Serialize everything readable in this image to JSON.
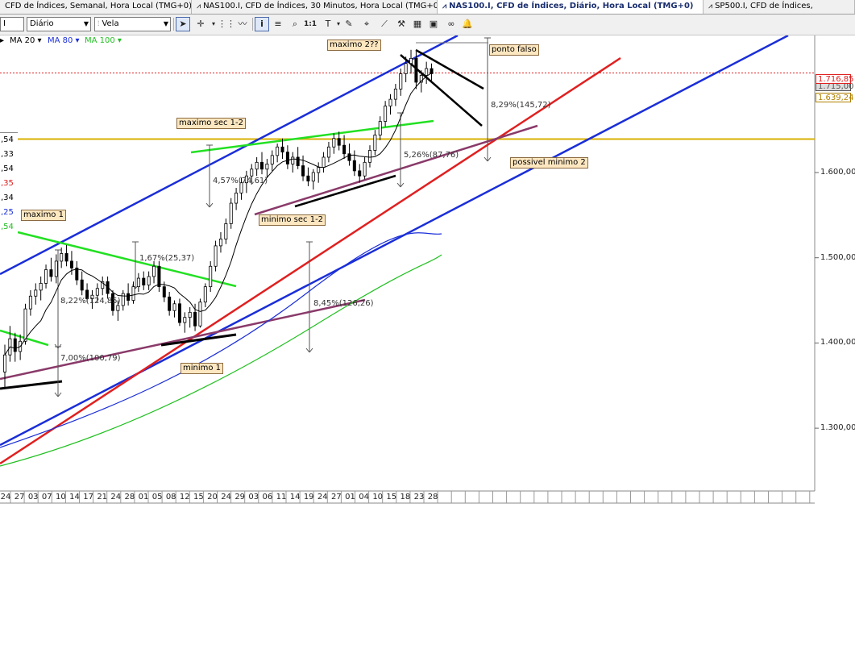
{
  "tabs": [
    {
      "label": "CFD de Índices, Semanal, Hora Local (TMG+0)",
      "active": false
    },
    {
      "label": "NAS100.I, CFD de Índices, 30 Minutos, Hora Local (TMG+0)",
      "active": false
    },
    {
      "label": "NAS100.I, CFD de Índices, Diário, Hora Local (TMG+0)",
      "active": true
    },
    {
      "label": "SP500.I, CFD de Índices,",
      "active": false
    }
  ],
  "toolbar": {
    "symbol_value": "I",
    "period_value": "Diário",
    "chart_type_value": "Vela",
    "buttons": [
      "cursor-icon",
      "crosshair-icon",
      "line-tool-icon",
      "grid-icon",
      "info-icon",
      "zoom-icon",
      "zoom-reset-label",
      "text-tool-icon",
      "draw-icon",
      "measure-icon",
      "indicator-icon",
      "table-icon",
      "compare-icon",
      "link-icon",
      "alert-icon"
    ],
    "zoom_reset_label": "1:1"
  },
  "ma_legend": {
    "ma20": {
      "label": "MA 20",
      "color": "#000000"
    },
    "ma80": {
      "label": "MA 80",
      "color": "#1a2ed8"
    },
    "ma100": {
      "label": "MA 100",
      "color": "#22c022"
    }
  },
  "left_table": [
    {
      "text": ",54",
      "color": "#000000"
    },
    {
      "text": ",33",
      "color": "#000000"
    },
    {
      "text": ",54",
      "color": "#000000"
    },
    {
      "text": ",35",
      "color": "#e02020"
    },
    {
      "text": ",34",
      "color": "#000000"
    },
    {
      "text": ",25",
      "color": "#1a2ed8"
    },
    {
      "text": ",54",
      "color": "#22c022"
    }
  ],
  "price_axis": {
    "ticks": [
      "1.600,00",
      "1.500,00",
      "1.400,00",
      "1.300,00"
    ],
    "tag_red": "1.716,85",
    "tag_yellow": "1.639,24",
    "tag_gray": "1.715,00"
  },
  "date_axis": [
    "24",
    "27",
    "03",
    "07",
    "10",
    "14",
    "17",
    "21",
    "24",
    "28",
    "01",
    "05",
    "08",
    "12",
    "15",
    "20",
    "24",
    "29",
    "03",
    "06",
    "11",
    "14",
    "19",
    "24",
    "27",
    "01",
    "04",
    "10",
    "15",
    "18",
    "23",
    "28"
  ],
  "annotations": {
    "maximo2": "maximo 2??",
    "ponto_falso": "ponto falso",
    "maximo_sec": "maximo sec 1-2",
    "maximo1": "maximo 1",
    "minimo_sec": "minimo sec 1-2",
    "minimo1": "minimo 1",
    "possivel_minimo2": "possivel minimo 2",
    "pct_829": "8,29%(145,72)",
    "pct_457": "4,57%(74,61)",
    "pct_526": "5,26%(87,76)",
    "pct_167": "1,67%(25,37)",
    "pct_822": "8,22%(124,85)",
    "pct_700": "7,00%(100,79)",
    "pct_845": "8,45%(126,26)"
  },
  "chart_data": {
    "type": "candlestick",
    "symbol": "NAS100.I",
    "timeframe": "Diário",
    "price_levels": {
      "red_dotted": 1716.85,
      "yellow": 1639.24
    },
    "y_ticks": [
      1600,
      1500,
      1400,
      1300
    ],
    "colors": {
      "ma20": "#000000",
      "ma80": "#1a2ed8",
      "ma100": "#22c022",
      "trend_blue": "#1a2ed8",
      "trend_red": "#e02020",
      "trend_green": "#22e022",
      "trend_purple": "#8a3a6a"
    },
    "candles": [
      [
        1366,
        1398,
        1348,
        1386
      ],
      [
        1386,
        1420,
        1378,
        1405
      ],
      [
        1405,
        1412,
        1378,
        1390
      ],
      [
        1390,
        1410,
        1380,
        1402
      ],
      [
        1402,
        1446,
        1398,
        1440
      ],
      [
        1440,
        1462,
        1432,
        1455
      ],
      [
        1455,
        1470,
        1445,
        1462
      ],
      [
        1462,
        1478,
        1450,
        1470
      ],
      [
        1470,
        1492,
        1464,
        1486
      ],
      [
        1486,
        1500,
        1472,
        1478
      ],
      [
        1478,
        1504,
        1470,
        1496
      ],
      [
        1496,
        1512,
        1488,
        1505
      ],
      [
        1505,
        1515,
        1490,
        1496
      ],
      [
        1496,
        1508,
        1480,
        1488
      ],
      [
        1488,
        1496,
        1468,
        1474
      ],
      [
        1474,
        1484,
        1456,
        1462
      ],
      [
        1462,
        1470,
        1448,
        1452
      ],
      [
        1452,
        1462,
        1440,
        1456
      ],
      [
        1456,
        1470,
        1448,
        1464
      ],
      [
        1464,
        1478,
        1456,
        1472
      ],
      [
        1472,
        1478,
        1452,
        1458
      ],
      [
        1458,
        1462,
        1432,
        1438
      ],
      [
        1438,
        1450,
        1426,
        1444
      ],
      [
        1444,
        1462,
        1438,
        1458
      ],
      [
        1458,
        1470,
        1444,
        1450
      ],
      [
        1450,
        1472,
        1446,
        1466
      ],
      [
        1466,
        1482,
        1460,
        1476
      ],
      [
        1476,
        1484,
        1462,
        1468
      ],
      [
        1468,
        1484,
        1462,
        1478
      ],
      [
        1478,
        1496,
        1470,
        1490
      ],
      [
        1490,
        1496,
        1460,
        1466
      ],
      [
        1466,
        1472,
        1448,
        1454
      ],
      [
        1454,
        1460,
        1432,
        1438
      ],
      [
        1438,
        1450,
        1430,
        1446
      ],
      [
        1446,
        1452,
        1420,
        1424
      ],
      [
        1424,
        1436,
        1412,
        1430
      ],
      [
        1430,
        1442,
        1418,
        1436
      ],
      [
        1436,
        1446,
        1414,
        1420
      ],
      [
        1420,
        1452,
        1418,
        1448
      ],
      [
        1448,
        1470,
        1442,
        1466
      ],
      [
        1466,
        1496,
        1460,
        1490
      ],
      [
        1490,
        1520,
        1484,
        1514
      ],
      [
        1514,
        1530,
        1506,
        1522
      ],
      [
        1522,
        1546,
        1516,
        1540
      ],
      [
        1540,
        1570,
        1534,
        1564
      ],
      [
        1564,
        1582,
        1556,
        1576
      ],
      [
        1576,
        1594,
        1568,
        1588
      ],
      [
        1588,
        1602,
        1576,
        1596
      ],
      [
        1596,
        1610,
        1586,
        1604
      ],
      [
        1604,
        1618,
        1596,
        1612
      ],
      [
        1612,
        1624,
        1598,
        1604
      ],
      [
        1604,
        1616,
        1594,
        1610
      ],
      [
        1610,
        1626,
        1602,
        1620
      ],
      [
        1620,
        1634,
        1612,
        1630
      ],
      [
        1630,
        1640,
        1616,
        1624
      ],
      [
        1624,
        1632,
        1604,
        1610
      ],
      [
        1610,
        1624,
        1600,
        1618
      ],
      [
        1618,
        1630,
        1604,
        1608
      ],
      [
        1608,
        1620,
        1590,
        1596
      ],
      [
        1596,
        1606,
        1584,
        1590
      ],
      [
        1590,
        1604,
        1580,
        1600
      ],
      [
        1600,
        1612,
        1588,
        1606
      ],
      [
        1606,
        1624,
        1600,
        1618
      ],
      [
        1618,
        1636,
        1612,
        1630
      ],
      [
        1630,
        1646,
        1622,
        1640
      ],
      [
        1640,
        1648,
        1626,
        1632
      ],
      [
        1632,
        1644,
        1616,
        1622
      ],
      [
        1622,
        1634,
        1608,
        1614
      ],
      [
        1614,
        1626,
        1596,
        1602
      ],
      [
        1602,
        1610,
        1588,
        1596
      ],
      [
        1596,
        1618,
        1592,
        1612
      ],
      [
        1612,
        1632,
        1606,
        1626
      ],
      [
        1626,
        1650,
        1620,
        1644
      ],
      [
        1644,
        1666,
        1638,
        1660
      ],
      [
        1660,
        1684,
        1654,
        1678
      ],
      [
        1678,
        1692,
        1668,
        1686
      ],
      [
        1686,
        1704,
        1678,
        1698
      ],
      [
        1698,
        1722,
        1690,
        1716
      ],
      [
        1716,
        1736,
        1706,
        1728
      ],
      [
        1728,
        1744,
        1716,
        1734
      ],
      [
        1734,
        1742,
        1698,
        1706
      ],
      [
        1706,
        1720,
        1694,
        1714
      ],
      [
        1714,
        1730,
        1704,
        1722
      ],
      [
        1722,
        1728,
        1708,
        1716
      ]
    ]
  }
}
